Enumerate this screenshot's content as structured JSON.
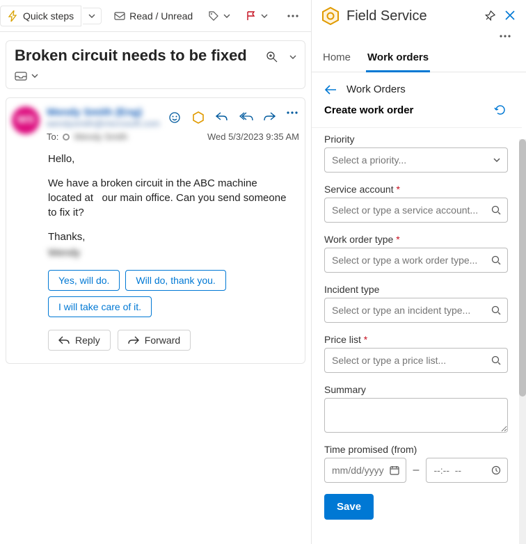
{
  "toolbar": {
    "quick_steps": "Quick steps",
    "read_unread": "Read / Unread"
  },
  "subject": "Broken circuit needs to be fixed",
  "email": {
    "from_name": "Wendy Smith (Eng)",
    "from_email": "wendysmith@microsoft.com",
    "to_label": "To:",
    "to_name": "Wendy Smith",
    "date": "Wed 5/3/2023 9:35 AM",
    "body_greeting": "Hello,",
    "body_main": "We have a broken circuit in the ABC machine located at   our main office. Can you send someone to fix it?",
    "body_thanks": "Thanks,",
    "body_sig": "Wendy",
    "suggestions": [
      "Yes, will do.",
      "Will do, thank you.",
      "I will take care of it."
    ],
    "reply_label": "Reply",
    "forward_label": "Forward"
  },
  "fs": {
    "title": "Field Service",
    "tabs": {
      "home": "Home",
      "work_orders": "Work orders"
    },
    "crumb": "Work Orders",
    "create_title": "Create work order",
    "labels": {
      "priority": "Priority",
      "service_account": "Service account",
      "work_order_type": "Work order type",
      "incident_type": "Incident type",
      "price_list": "Price list",
      "summary": "Summary",
      "time_from": "Time promised (from)"
    },
    "placeholders": {
      "priority": "Select a priority...",
      "service_account": "Select or type a service account...",
      "work_order_type": "Select or type a work order type...",
      "incident_type": "Select or type an incident type...",
      "price_list": "Select or type a price list...",
      "date": "mm/dd/yyyy",
      "time": "--:--  --"
    },
    "save": "Save"
  }
}
